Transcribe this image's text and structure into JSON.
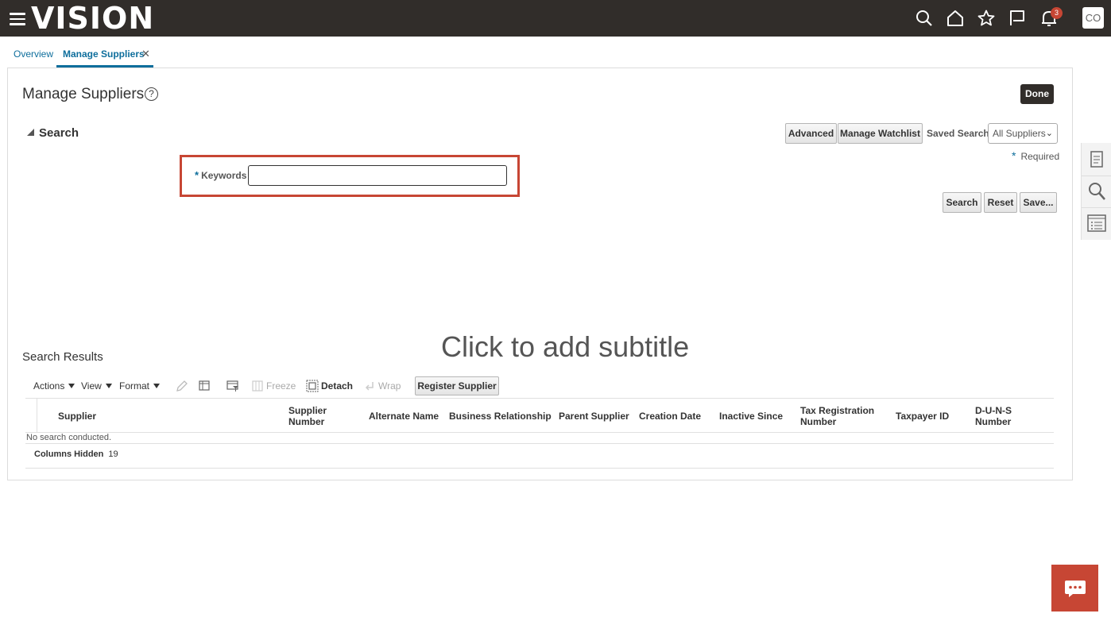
{
  "header": {
    "logo_text": "VISION",
    "notification_count": "3",
    "user_initials": "CO",
    "icons": [
      "menu-icon",
      "search-icon",
      "home-icon",
      "star-icon",
      "flag-icon",
      "bell-icon"
    ]
  },
  "tabs": [
    {
      "label": "Overview"
    },
    {
      "label": "Manage Suppliers",
      "active": true,
      "closable": true
    }
  ],
  "page": {
    "title": "Manage Suppliers",
    "help_glyph": "?",
    "done_label": "Done"
  },
  "search": {
    "section_title": "Search",
    "advanced_label": "Advanced",
    "watchlist_label": "Manage Watchlist",
    "saved_search_label": "Saved Search",
    "saved_search_value": "All Suppliers",
    "required_label": "Required",
    "keywords_label": "Keywords",
    "keywords_value": "",
    "search_btn": "Search",
    "reset_btn": "Reset",
    "save_btn": "Save..."
  },
  "overlay": {
    "subtitle_placeholder": "Click to add subtitle"
  },
  "results": {
    "title": "Search Results",
    "toolbar": {
      "actions": "Actions",
      "view": "View",
      "format": "Format",
      "freeze": "Freeze",
      "detach": "Detach",
      "wrap": "Wrap",
      "register": "Register Supplier"
    },
    "columns": [
      "Supplier",
      "Supplier Number",
      "Alternate Name",
      "Business Relationship",
      "Parent Supplier",
      "Creation Date",
      "Inactive Since",
      "Tax Registration Number",
      "Taxpayer ID",
      "D-U-N-S Number"
    ],
    "empty_text": "No search conducted.",
    "columns_hidden_label": "Columns Hidden",
    "columns_hidden_count": "19"
  },
  "colors": {
    "header_bg": "#312d2a",
    "accent": "#0e6e9c",
    "highlight": "#c74634"
  }
}
